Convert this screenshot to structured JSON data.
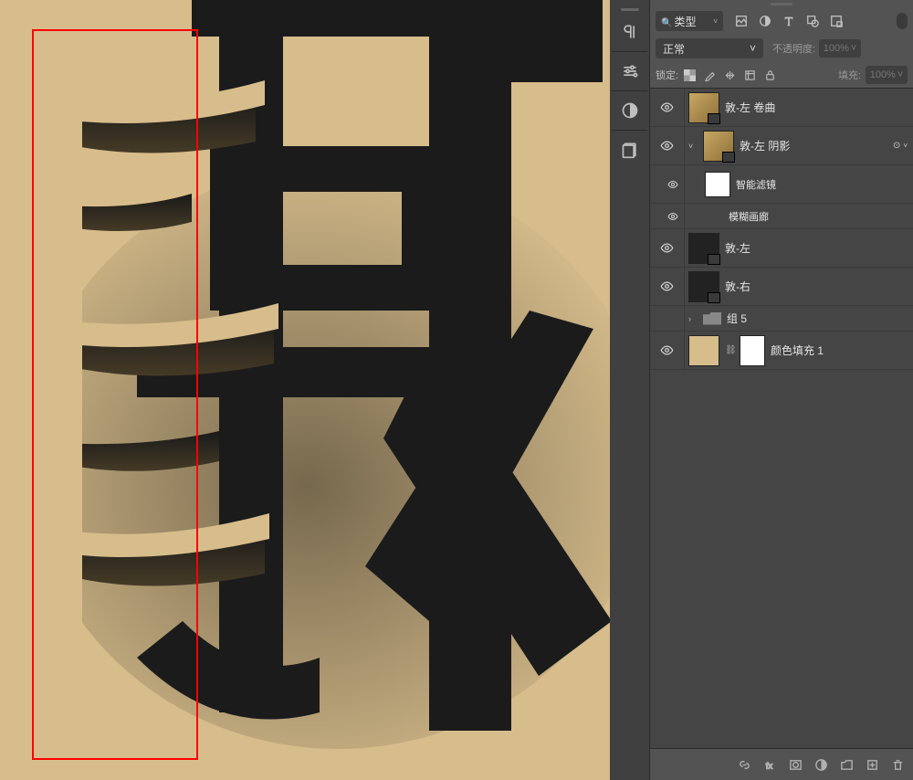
{
  "filter": {
    "label": "类型",
    "search_glyph": "🔍"
  },
  "blend": {
    "mode": "正常",
    "opacity_label": "不透明度:",
    "opacity_value": "100%"
  },
  "lock": {
    "label": "锁定:",
    "fill_label": "填充:",
    "fill_value": "100%"
  },
  "layers": [
    {
      "name": "敦-左 卷曲"
    },
    {
      "name": "敦-左 阴影"
    },
    {
      "name": "智能滤镜"
    },
    {
      "name": "模糊画廊"
    },
    {
      "name": "敦-左"
    },
    {
      "name": "敦-右"
    },
    {
      "name": "组 5"
    },
    {
      "name": "颜色填充 1"
    }
  ],
  "fx_marker": "⊙",
  "chevron": "˅"
}
